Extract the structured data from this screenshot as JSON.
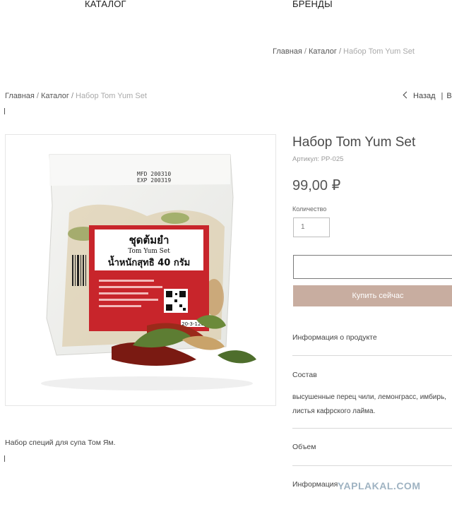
{
  "nav": {
    "catalog": "КАТАЛОГ",
    "brands": "БРЕНДЫ"
  },
  "breadcrumb": {
    "home": "Главная",
    "separator": "/",
    "catalog": "Каталог",
    "current": "Набор Tom Yum Set"
  },
  "back_nav": {
    "back": "Назад",
    "next": "В"
  },
  "product": {
    "title": "Набор Tom Yum Set",
    "sku": "Артикул: PP-025",
    "price": "99,00 ₽",
    "quantity_label": "Количество",
    "quantity_value": "1",
    "buy_now": "Купить сейчас",
    "description": "Набор специй для супа Том Ям."
  },
  "package_label": {
    "thai_title": "ชุดต้มยำ",
    "english_title": "Tom Yum Set",
    "weight": "น้ำหนักสุทธิ 40 กรัม",
    "mfd": "MFD 200310",
    "exp": "EXP 200319",
    "lot": "20-3-120"
  },
  "sections": {
    "info": "Информация о продукте",
    "composition": "Состав",
    "composition_text": "высушенные перец чили, лемонграсс, имбирь, листья кафрского лайма.",
    "volume": "Объем",
    "more": "Информация"
  },
  "watermark": "YAPLAKAL.COM",
  "colors": {
    "buy_button": "#c8ada0",
    "label_red": "#c8252b"
  }
}
